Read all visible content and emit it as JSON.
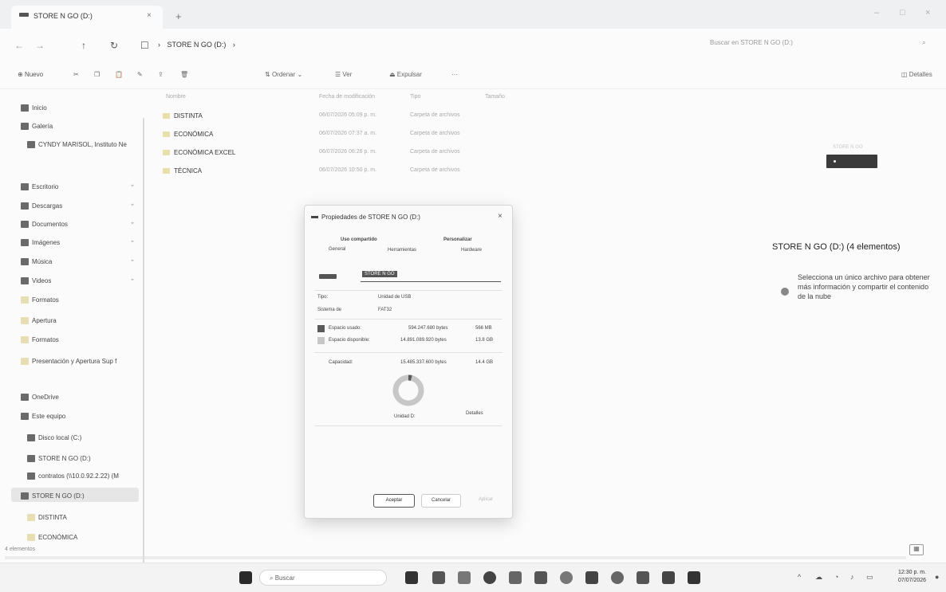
{
  "window": {
    "tab_title": "STORE N GO (D:)",
    "tab_close": "×",
    "tab_add": "+",
    "min": "–",
    "max": "□",
    "close": "×"
  },
  "nav": {
    "back": "←",
    "forward": "→",
    "up": "↑",
    "refresh": "↻",
    "monitor": "☐",
    "breadcrumb": "STORE N GO (D:)",
    "search_placeholder": "Buscar en STORE N GO (D:)"
  },
  "commands": {
    "new": "Nuevo",
    "sort": "Ordenar",
    "view": "Ver",
    "eject": "Expulsar",
    "more": "···",
    "details": "Detalles"
  },
  "sidebar": {
    "items": [
      {
        "label": "Inicio",
        "icon": "home-icon"
      },
      {
        "label": "Galería",
        "icon": "gallery-icon"
      },
      {
        "label": "CYNDY MARISOL, Instituto Ne",
        "icon": "cloud-icon"
      },
      {
        "label": "Escritorio",
        "icon": "desktop-icon"
      },
      {
        "label": "Descargas",
        "icon": "download-icon"
      },
      {
        "label": "Documentos",
        "icon": "document-icon"
      },
      {
        "label": "Imágenes",
        "icon": "pictures-icon"
      },
      {
        "label": "Música",
        "icon": "music-icon"
      },
      {
        "label": "Videos",
        "icon": "video-icon"
      },
      {
        "label": "Formatos",
        "icon": "folder-icon"
      },
      {
        "label": "Apertura",
        "icon": "folder-icon"
      },
      {
        "label": "Formatos",
        "icon": "folder-icon"
      },
      {
        "label": "Presentación y Apertura Sup f",
        "icon": "folder-icon"
      },
      {
        "label": "OneDrive",
        "icon": "onedrive-icon"
      },
      {
        "label": "Este equipo",
        "icon": "pc-icon"
      },
      {
        "label": "Disco local (C:)",
        "icon": "disk-icon"
      },
      {
        "label": "STORE N GO (D:)",
        "icon": "usb-icon"
      },
      {
        "label": "contratos (\\\\10.0.92.2.22) (M",
        "icon": "network-icon"
      },
      {
        "label": "STORE N GO (D:)",
        "icon": "usb-icon"
      },
      {
        "label": "DISTINTA",
        "icon": "folder-icon"
      },
      {
        "label": "ECONÓMICA",
        "icon": "folder-icon"
      }
    ]
  },
  "files": {
    "headers": {
      "name": "Nombre",
      "date": "Fecha de modificación",
      "type": "Tipo",
      "size": "Tamaño"
    },
    "rows": [
      {
        "name": "DISTINTA",
        "date": "06/07/2026 05:09 p. m.",
        "type": "Carpeta de archivos"
      },
      {
        "name": "ECONÓMICA",
        "date": "06/07/2026 07:37 a. m.",
        "type": "Carpeta de archivos"
      },
      {
        "name": "ECONÓMICA EXCEL",
        "date": "06/07/2026 06:26 p. m.",
        "type": "Carpeta de archivos"
      },
      {
        "name": "TÉCNICA",
        "date": "06/07/2026 10:50 p. m.",
        "type": "Carpeta de archivos"
      }
    ]
  },
  "details_pane": {
    "title": "STORE N GO (D:) (4 elementos)",
    "message": "Selecciona un único archivo para obtener más información y compartir el contenido de la nube",
    "thumb_label": "STORE N GO"
  },
  "dialog": {
    "title": "Propiedades de STORE N GO (D:)",
    "close": "×",
    "tabs_top": [
      "Uso compartido",
      "Personalizar"
    ],
    "tabs_bottom": [
      "General",
      "Herramientas",
      "Hardware"
    ],
    "name_value": "STORE N GO",
    "type_label": "Tipo:",
    "type_value": "Unidad de USB",
    "fs_label": "Sistema de",
    "fs_value": "FAT32",
    "used_label": "Espacio usado:",
    "used_bytes": "594.247.680 bytes",
    "used_short": "566 MB",
    "free_label": "Espacio disponible:",
    "free_bytes": "14.891.089.920 bytes",
    "free_short": "13.8 GB",
    "cap_label": "Capacidad:",
    "cap_bytes": "15.485.337.600 bytes",
    "cap_short": "14.4 GB",
    "drive_label": "Unidad D:",
    "details_btn": "Detalles",
    "ok": "Aceptar",
    "cancel": "Cancelar",
    "apply": "Aplicar",
    "used_fraction": 0.038,
    "used_color": "#5a5a5a",
    "free_color": "#c7c7c7"
  },
  "status": {
    "items": "4 elementos"
  },
  "taskbar": {
    "search": "Buscar",
    "time": "12:30 p. m.",
    "date": "07/07/2026"
  }
}
